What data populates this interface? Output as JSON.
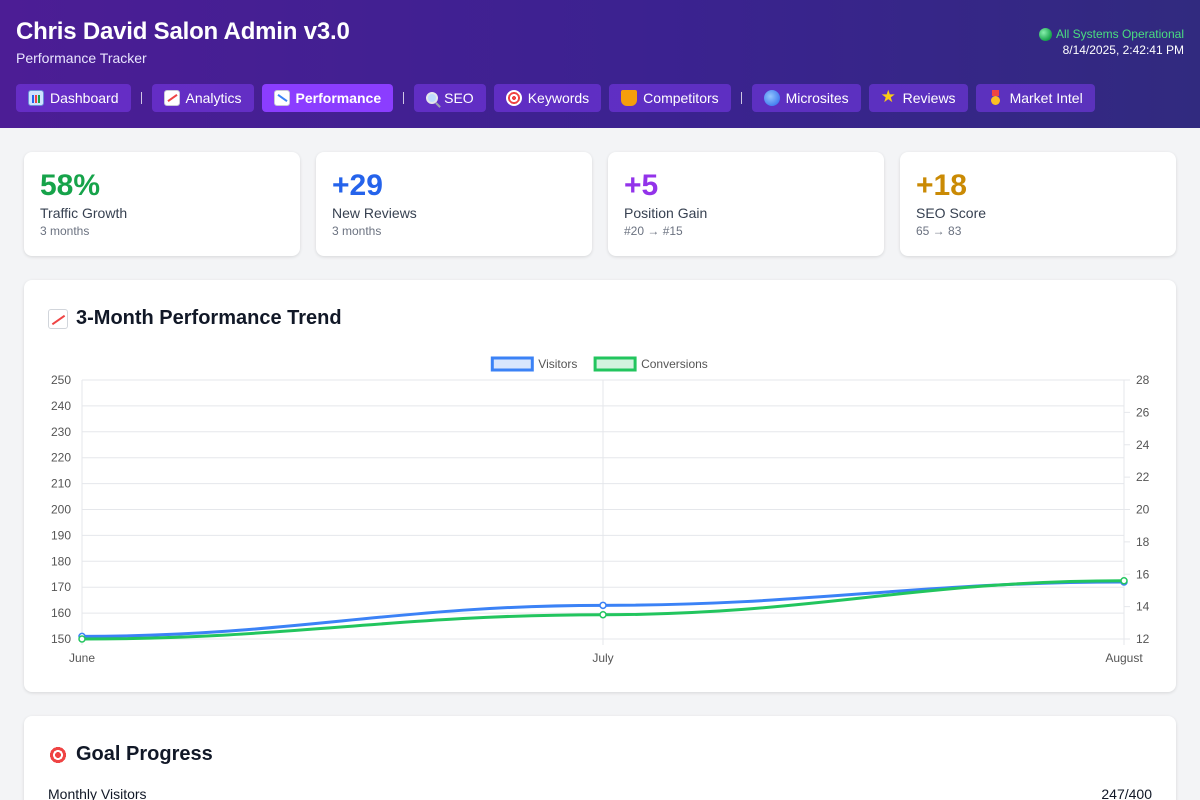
{
  "header": {
    "title": "Chris David Salon Admin v3.0",
    "subtitle": "Performance Tracker",
    "status": "All Systems Operational",
    "datetime": "8/14/2025, 2:42:41 PM"
  },
  "nav": {
    "dashboard": "Dashboard",
    "analytics": "Analytics",
    "performance": "Performance",
    "seo": "SEO",
    "keywords": "Keywords",
    "competitors": "Competitors",
    "microsites": "Microsites",
    "reviews": "Reviews",
    "market_intel": "Market Intel",
    "active": "Performance"
  },
  "stats": [
    {
      "value": "58%",
      "label": "Traffic Growth",
      "sub": "3 months",
      "color": "#16a34a"
    },
    {
      "value": "+29",
      "label": "New Reviews",
      "sub": "3 months",
      "color": "#2563eb"
    },
    {
      "value": "+5",
      "label": "Position Gain",
      "sub": "#20 → #15",
      "color": "#9333ea"
    },
    {
      "value": "+18",
      "label": "SEO Score",
      "sub": "65 → 83",
      "color": "#ca8a04"
    }
  ],
  "chart_section": {
    "title": "3-Month Performance Trend"
  },
  "chart_data": {
    "type": "line",
    "x": [
      "June",
      "July",
      "August"
    ],
    "series": [
      {
        "name": "Visitors",
        "axis": "left",
        "color": "#3b82f6",
        "values": [
          151,
          163,
          172
        ]
      },
      {
        "name": "Conversions",
        "axis": "right",
        "color": "#22c55e",
        "values": [
          12,
          13.5,
          15.6
        ]
      }
    ],
    "y_left": {
      "min": 150,
      "max": 250,
      "ticks": [
        150,
        160,
        170,
        180,
        190,
        200,
        210,
        220,
        230,
        240,
        250
      ]
    },
    "y_right": {
      "min": 12,
      "max": 28,
      "ticks": [
        12,
        14,
        16,
        18,
        20,
        22,
        24,
        26,
        28
      ]
    },
    "grid": true,
    "legend": "top-center",
    "title": "",
    "xlabel": "",
    "ylabel": ""
  },
  "goals": {
    "title": "Goal Progress",
    "items": [
      {
        "label": "Monthly Visitors",
        "value": "247/400"
      }
    ]
  }
}
